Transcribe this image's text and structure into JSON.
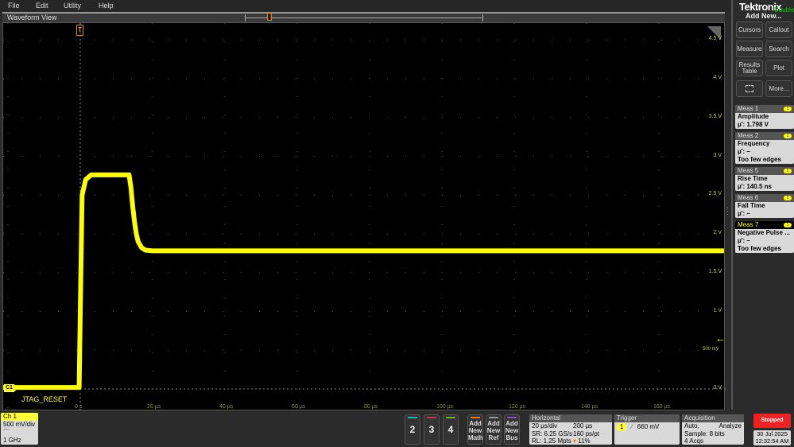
{
  "menu": {
    "items": [
      "File",
      "Edit",
      "Utility",
      "Help"
    ]
  },
  "waveform_view": {
    "title": "Waveform View",
    "channel_marker": "C1",
    "channel_label": "JTAG_RESET",
    "trigger_marker": "T",
    "trigger_level_label": "500 mV",
    "color": "#ffff00",
    "volt_labels": [
      "4.5 V",
      "4 V",
      "3.5 V",
      "3 V",
      "2.5 V",
      "2 V",
      "1.5 V",
      "1 V",
      "0 V"
    ],
    "time_labels": [
      "0 s",
      "20 µs",
      "40 µs",
      "60 µs",
      "80 µs",
      "100 µs",
      "120 µs",
      "140 µs",
      "160 µs"
    ]
  },
  "chart_data": {
    "type": "line",
    "xunit": "µs",
    "yunit": "V",
    "xlim": [
      -22,
      178
    ],
    "ylim": [
      0,
      5
    ],
    "grid": true,
    "series": [
      {
        "x": [
          -22,
          -0.3,
          0,
          0.5,
          1.5,
          3,
          13.5,
          14,
          14.5,
          15,
          15.5,
          16,
          17,
          18,
          20,
          178
        ],
        "values": [
          0.02,
          0.02,
          1.0,
          2.5,
          2.7,
          2.76,
          2.76,
          2.6,
          2.35,
          2.15,
          2.0,
          1.9,
          1.82,
          1.79,
          1.78,
          1.78
        ]
      }
    ]
  },
  "right_panel": {
    "brand": "Tektronix",
    "hint": "Double t",
    "add_new": "Add New...",
    "buttons": [
      "Cursors",
      "Callout",
      "Measure",
      "Search",
      "Results Table",
      "Plot",
      "More..."
    ],
    "zoom_icon": "zoom-box-icon",
    "measurements": [
      {
        "header": "Meas 1",
        "badge": "1",
        "name": "Amplitude",
        "lines": [
          "µ': 1.798 V"
        ]
      },
      {
        "header": "Meas 2",
        "badge": "1",
        "name": "Frequency",
        "lines": [
          "µ': –",
          "Too few edges"
        ]
      },
      {
        "header": "Meas 5",
        "badge": "1",
        "name": "Rise Time",
        "lines": [
          "µ': 140.5 ns"
        ]
      },
      {
        "header": "Meas 6",
        "badge": "1",
        "name": "Fall Time",
        "lines": [
          "µ': –"
        ]
      },
      {
        "header": "Meas 7",
        "badge": "1",
        "name": "Negative Pulse ...",
        "lines": [
          "µ': –",
          "Too few edges"
        ],
        "selected": true
      }
    ]
  },
  "bottom": {
    "ch1": {
      "header": "Ch 1",
      "scale": "500 mV/div",
      "bandwidth": "1 GHz"
    },
    "channels": [
      {
        "label": "2",
        "color": "#22b5b5"
      },
      {
        "label": "3",
        "color": "#c8384a"
      },
      {
        "label": "4",
        "color": "#6ab42a"
      }
    ],
    "add": [
      {
        "label": "Add New Math",
        "color": "#e07b20"
      },
      {
        "label": "Add New Ref",
        "color": "#999999"
      },
      {
        "label": "Add New Bus",
        "color": "#8a4fc8"
      }
    ],
    "horizontal": {
      "header": "Horizontal",
      "scale": "20 µs/div",
      "position": "200 µs",
      "sr": "SR: 6.25 GS/s",
      "resolution": "160 ps/pt",
      "rl": "RL: 1.25 Mpts",
      "trigger_pos": "11%"
    },
    "trigger": {
      "header": "Trigger",
      "source": "1",
      "level": "660 mV"
    },
    "acquisition": {
      "header": "Acquisition",
      "mode": "Auto,",
      "analyze": "Analyze",
      "sample": "Sample: 8 bits",
      "acqs": "4 Acqs"
    },
    "status": "Stopped",
    "date": "30 Jul 2025",
    "time": "12:32:54 AM"
  }
}
